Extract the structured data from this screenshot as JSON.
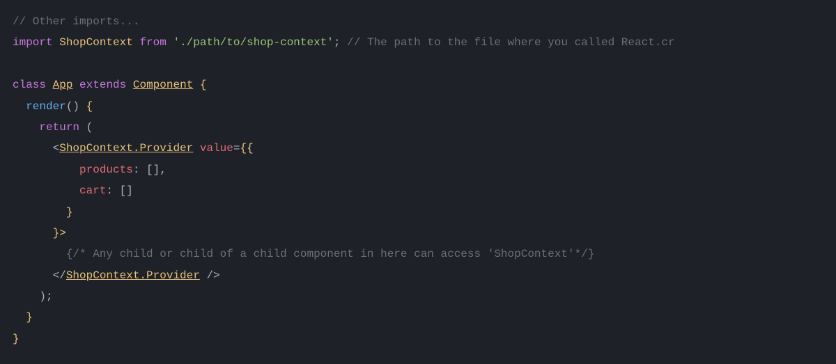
{
  "code": {
    "line1_comment": "// Other imports...",
    "line2": {
      "import": "import",
      "identifier": "ShopContext",
      "from": "from",
      "path": "'./path/to/shop-context'",
      "semicolon": ";",
      "comment": " // The path to the file where you called React.cr"
    },
    "line3_empty": "",
    "line4": {
      "class": "class",
      "app": "App",
      "extends": "extends",
      "component": "Component",
      "brace": " {"
    },
    "line5": {
      "render": "render",
      "parens": "()",
      "brace": " {"
    },
    "line6": {
      "return": "return",
      "paren": " ("
    },
    "line7": {
      "lt": "<",
      "component": "ShopContext.Provider",
      "space": " ",
      "attr": "value",
      "equals": "=",
      "braces": "{{"
    },
    "line8": {
      "key": "products",
      "colon": ":",
      "value": " []",
      "comma": ","
    },
    "line9": {
      "key": "cart",
      "colon": ":",
      "value": " []"
    },
    "line10": {
      "brace": "}"
    },
    "line11": {
      "close": "}>"
    },
    "line12": {
      "comment": "{/*  Any child or child of a child component in here can access 'ShopContext'*/}"
    },
    "line13": {
      "lt": "</",
      "component": "ShopContext.Provider",
      "close": " />"
    },
    "line14": {
      "close": ");"
    },
    "line15": {
      "brace": "}"
    },
    "line16": {
      "brace": "}"
    }
  }
}
